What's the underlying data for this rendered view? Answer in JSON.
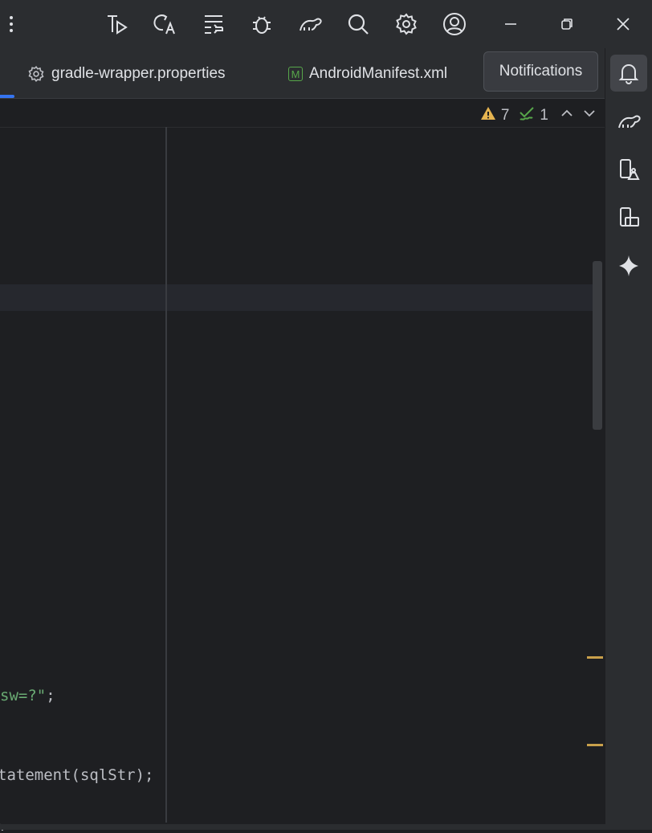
{
  "titlebar": {
    "icons": [
      "more-vert-icon",
      "build-run-icon",
      "translate-icon",
      "wrap-lines-icon",
      "debug-icon",
      "gradle-sync-icon",
      "search-icon",
      "settings-icon",
      "account-icon",
      "minimize-icon",
      "restore-icon",
      "close-icon"
    ]
  },
  "tabs": [
    {
      "label": "gradle-wrapper.properties",
      "icon": "gear-icon"
    },
    {
      "label": "AndroidManifest.xml",
      "icon": "manifest-icon",
      "icon_letter": "M"
    }
  ],
  "tooltip": {
    "text": "Notifications"
  },
  "inspections": {
    "warnings": "7",
    "weak_warnings": "1"
  },
  "code": {
    "line1_str": "sw=?\"",
    "line1_rest": ";",
    "line2": "tatement(sqlStr);",
    "line3": "\\"
  },
  "colors": {
    "accent": "#3574f0",
    "string": "#6aab73",
    "marker": "#c9a04b",
    "warning": "#e6b450"
  },
  "rightbar": {
    "icons": [
      "notifications-icon",
      "gradle-icon",
      "device-manager-icon",
      "running-devices-icon",
      "gemini-icon"
    ]
  }
}
